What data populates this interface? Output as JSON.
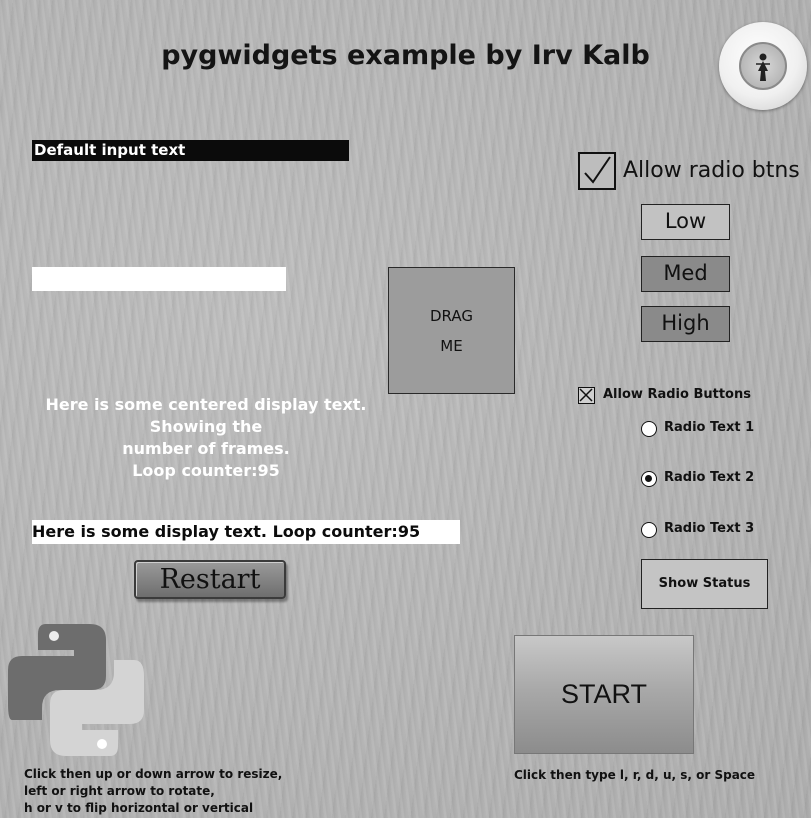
{
  "header": {
    "title": "pygwidgets example by Irv Kalb",
    "logo_icon": "badge-logo-icon"
  },
  "input_dark": {
    "value": "Default input text"
  },
  "input_white": {
    "value": ""
  },
  "drag_box": {
    "line1": "DRAG",
    "line2": "ME"
  },
  "centered_text": {
    "line1": "Here is some centered display text.",
    "line2": "Showing the",
    "line3": "number of frames.",
    "line4": "Loop counter:95"
  },
  "display_text": {
    "value": "Here is some display text.  Loop counter:95"
  },
  "restart_button": {
    "label": "Restart"
  },
  "python_image": {
    "icon": "python-logo-icon"
  },
  "instructions_left": {
    "line1": "Click then up or down arrow to resize,",
    "line2": "left or right arrow to rotate,",
    "line3": "h or v to flip horizontal or vertical"
  },
  "start_button": {
    "label": "START"
  },
  "instructions_right": {
    "value": "Click then type l, r, d, u, s, or Space"
  },
  "checkbox_allow_radio_btns": {
    "label": "Allow radio btns",
    "checked": true
  },
  "radio_buttons": [
    {
      "label": "Low",
      "selected": true
    },
    {
      "label": "Med",
      "selected": false
    },
    {
      "label": "High",
      "selected": false
    }
  ],
  "checkbox_allow_radio_buttons": {
    "label": "Allow Radio Buttons",
    "checked": true
  },
  "text_radio_buttons": [
    {
      "label": "Radio Text 1",
      "selected": false
    },
    {
      "label": "Radio Text 2",
      "selected": true
    },
    {
      "label": "Radio Text 3",
      "selected": false
    }
  ],
  "show_status_button": {
    "label": "Show Status"
  },
  "colors": {
    "background": "#b3b3b3",
    "input_dark_bg": "#0b0b0b",
    "selected_radio_btn": "#c2c2c2",
    "unselected_radio_btn": "#8a8a8a"
  }
}
